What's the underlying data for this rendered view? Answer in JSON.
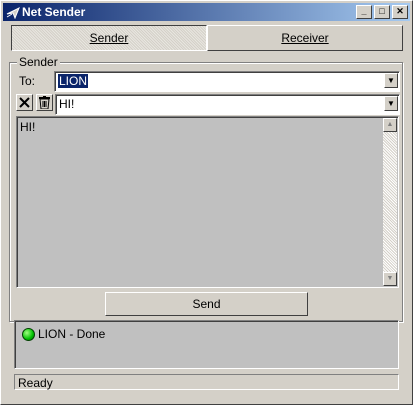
{
  "window": {
    "title": "Net Sender",
    "controls": {
      "minimize": "_",
      "maximize": "□",
      "close": "✕"
    }
  },
  "tabs": [
    {
      "label": "Sender",
      "active": true
    },
    {
      "label": "Receiver",
      "active": false
    }
  ],
  "sender": {
    "group_label": "Sender",
    "to_label": "To:",
    "to_value": "LION",
    "message_history_value": "HI!",
    "message_body": "HI!",
    "clear_icon": "x-icon",
    "delete_icon": "trash-icon",
    "send_label": "Send"
  },
  "status": {
    "entry": "LION - Done",
    "led_color": "#00c000"
  },
  "statusbar": {
    "text": "Ready"
  }
}
